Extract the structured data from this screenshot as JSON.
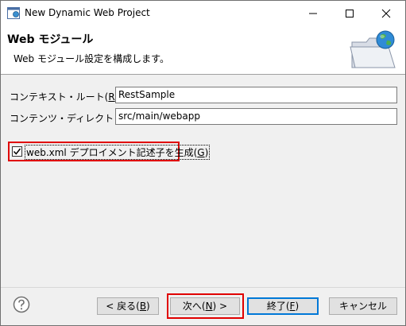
{
  "window": {
    "title": "New Dynamic Web Project"
  },
  "header": {
    "title": "Web モジュール",
    "description": "Web モジュール設定を構成します。"
  },
  "form": {
    "context_root": {
      "label": "コンテキスト・ルート(",
      "mnemonic": "R",
      "label_end": "):",
      "value": "RestSample"
    },
    "content_dir": {
      "label": "コンテンツ・ディレクトリー(",
      "mnemonic": "D",
      "label_end": "):",
      "value": "src/main/webapp"
    },
    "generate_webxml": {
      "label": "web.xml デプロイメント記述子を生成(",
      "mnemonic": "G",
      "label_end": ")",
      "checked": true
    }
  },
  "buttons": {
    "back": {
      "label": "< 戻る(",
      "mnemonic": "B",
      "label_end": ")"
    },
    "next": {
      "label": "次へ(",
      "mnemonic": "N",
      "label_end": ") >"
    },
    "finish": {
      "label": "終了(",
      "mnemonic": "F",
      "label_end": ")"
    },
    "cancel": {
      "label": "キャンセル"
    }
  },
  "colors": {
    "accent": "#0078d7",
    "highlight": "#e00000",
    "dialog_bg": "#f0f0f0"
  },
  "icons": [
    "eclipse-app-icon",
    "minimize-icon",
    "maximize-icon",
    "close-icon",
    "web-folder-globe-icon",
    "help-icon",
    "checkmark-icon"
  ]
}
